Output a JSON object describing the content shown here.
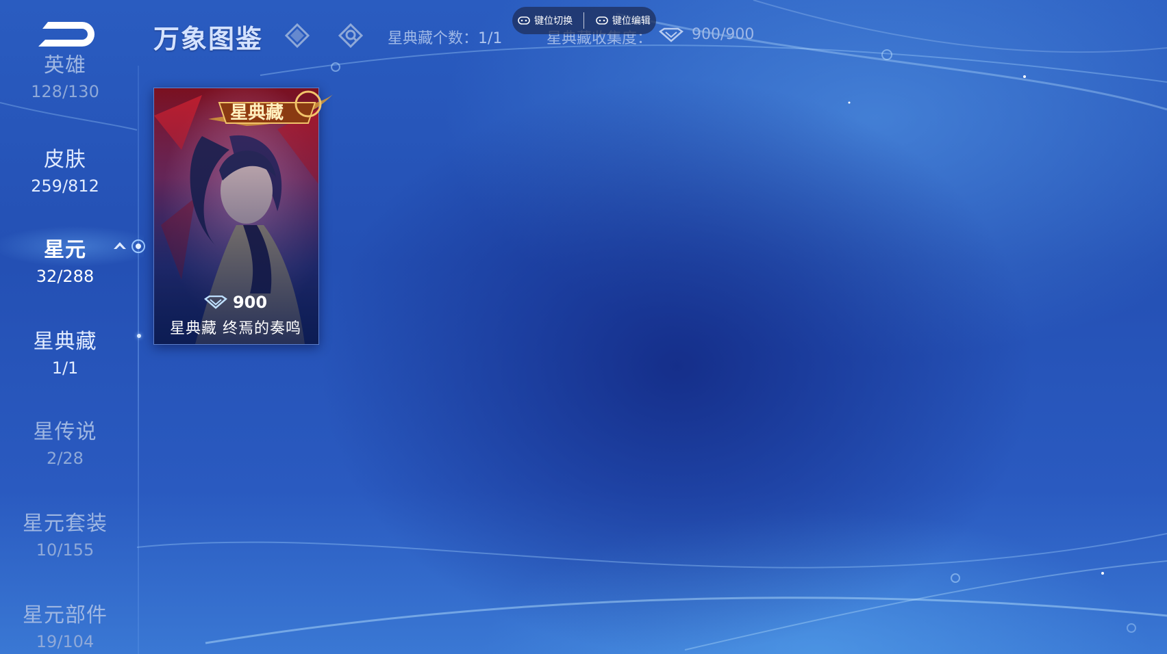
{
  "page": {
    "title": "万象图鉴"
  },
  "keybar": {
    "switch_label": "键位切换",
    "edit_label": "键位编辑"
  },
  "stats": {
    "count_label": "星典藏个数：",
    "count_value": "1/1",
    "collection_label": "星典藏收集度：",
    "collection_value": "900/900"
  },
  "sidebar": {
    "items": [
      {
        "label": "英雄",
        "count": "128/130"
      },
      {
        "label": "皮肤",
        "count": "259/812"
      },
      {
        "label": "星元",
        "count": "32/288"
      },
      {
        "label": "星典藏",
        "count": "1/1"
      },
      {
        "label": "星传说",
        "count": "2/28"
      },
      {
        "label": "星元套装",
        "count": "10/155"
      },
      {
        "label": "星元部件",
        "count": "19/104"
      }
    ]
  },
  "cards": [
    {
      "badge": "星典藏",
      "value": "900",
      "name": "星典藏  终焉的奏鸣"
    }
  ],
  "colors": {
    "accent": "#9cc8ff",
    "background": "#2450b4"
  }
}
